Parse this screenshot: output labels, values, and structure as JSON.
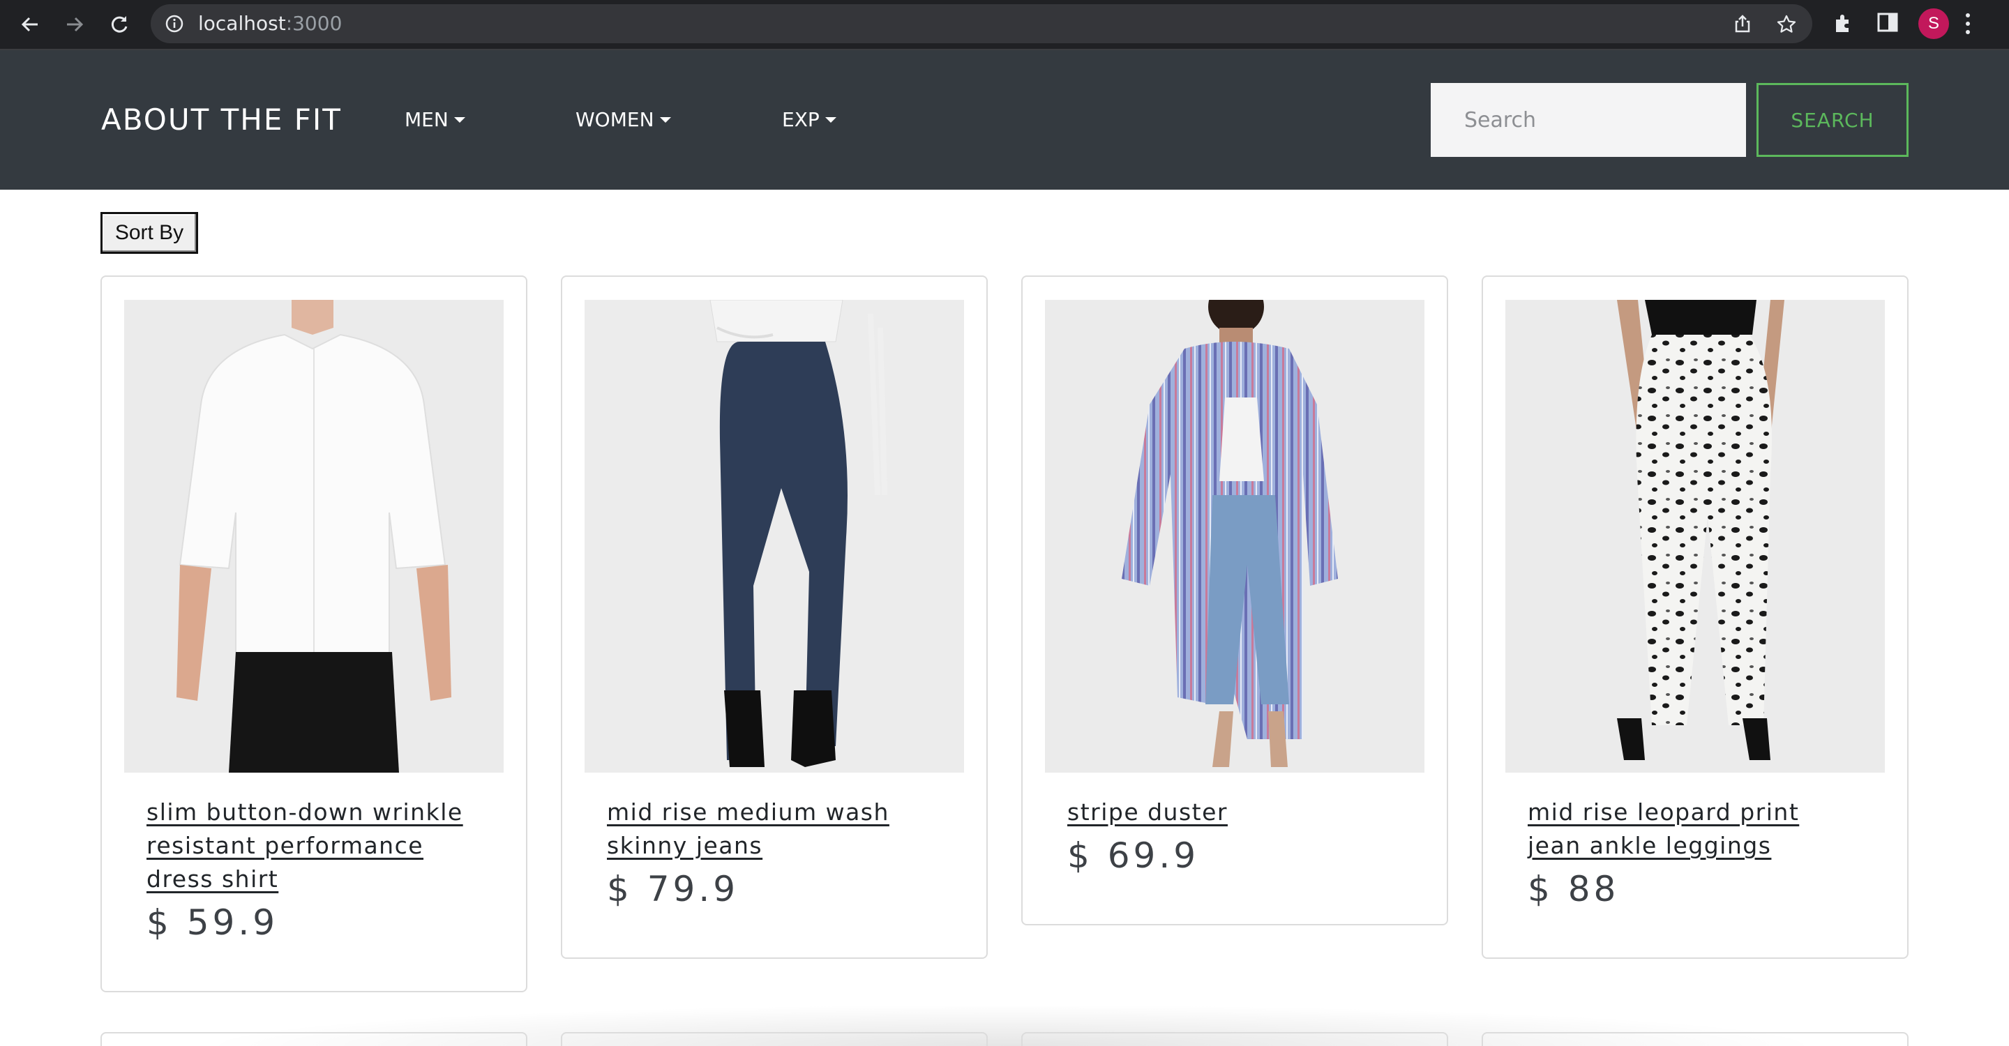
{
  "browser": {
    "url_host": "localhost",
    "url_port": ":3000",
    "profile_initial": "S",
    "icons": [
      "back-icon",
      "forward-icon",
      "reload-icon",
      "info-icon",
      "share-icon",
      "star-icon",
      "extensions-icon",
      "side-panel-icon",
      "menu-icon"
    ]
  },
  "navbar": {
    "brand": "ABOUT THE FIT",
    "menus": [
      {
        "label": "MEN"
      },
      {
        "label": "WOMEN"
      },
      {
        "label": "EXP"
      }
    ],
    "search_placeholder": "Search",
    "search_button": "SEARCH"
  },
  "sort_button": "Sort By",
  "products": [
    {
      "title": "slim button-down wrinkle resistant performance dress shirt",
      "price": "$ 59.9"
    },
    {
      "title": "mid rise medium wash skinny jeans",
      "price": "$ 79.9"
    },
    {
      "title": "stripe duster",
      "price": "$ 69.9"
    },
    {
      "title": "mid rise leopard print jean ankle leggings",
      "price": "$ 88"
    }
  ],
  "colors": {
    "navbar_bg": "#343a40",
    "accent_green": "#5cb85c",
    "chrome_bg": "#202124"
  }
}
